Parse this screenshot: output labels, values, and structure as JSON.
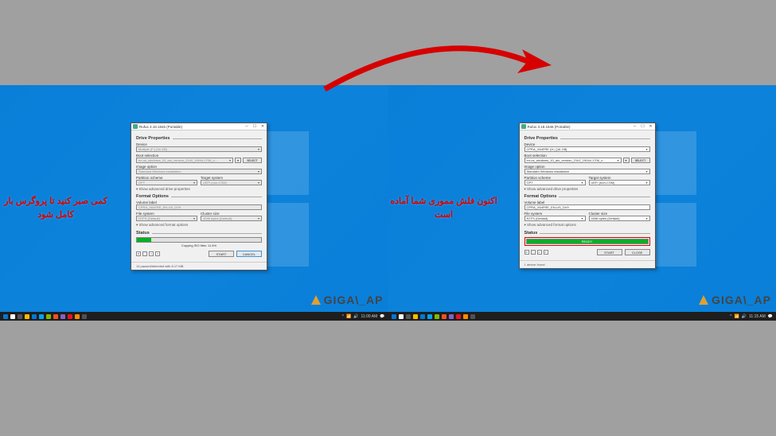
{
  "captions": {
    "left": "کمی صبر کنید تا پروگرس بار کامل شود",
    "right": "اکنون فلش مموری شما آماده است"
  },
  "watermark": "GIGA\\_AP",
  "arrow_color": "#d60000",
  "rufus": {
    "title": "Rufus 3.18.1846 (Portable)",
    "sections": {
      "drive_props": "Drive Properties",
      "format_opts": "Format Options",
      "status": "Status"
    },
    "labels": {
      "device": "Device",
      "boot_selection": "Boot selection",
      "image_option": "Image option",
      "partition_scheme": "Partition scheme",
      "target_system": "Target system",
      "adv_drive": "Show advanced drive properties",
      "volume_label": "Volume label",
      "file_system": "File system",
      "cluster_size": "Cluster size",
      "adv_format": "Show advanced format options"
    },
    "buttons": {
      "select": "SELECT",
      "start": "START",
      "cancel": "CANCEL",
      "close": "CLOSE"
    },
    "left_values": {
      "device": "Multiple (F:) [16 GB]",
      "boot": "en-us_windows_10_aio_version_21h2_19044.1706_x...",
      "image_option": "Standard Windows installation",
      "partition": "GPT",
      "target": "UEFI (non-CSM)",
      "volume": "CPRA_X64FRE_EN-US_DV9",
      "fs": "NTFS (Default)",
      "cluster": "4096 bytes (Default)",
      "progress_text": "Copying ISO files: 11.4%",
      "progress_pct": 11.4,
      "footer": "14 paused/detected with 8.17 MB"
    },
    "right_values": {
      "device": "CPRA_X64FRE (H:) [16 GB]",
      "boot": "en-us_windows_10_aio_version_21h2_19044.1706_x...",
      "image_option": "Standard Windows installation",
      "partition": "GPT",
      "target": "UEFI (non-CSM)",
      "volume": "CPRA_X64FRE_EN-US_DV9",
      "fs": "NTFS (Default)",
      "cluster": "4096 bytes (Default)",
      "ready_text": "READY",
      "footer": "1 device found"
    }
  },
  "taskbar": {
    "time_left": "11:09 AM",
    "time_right": "11:15 AM"
  }
}
